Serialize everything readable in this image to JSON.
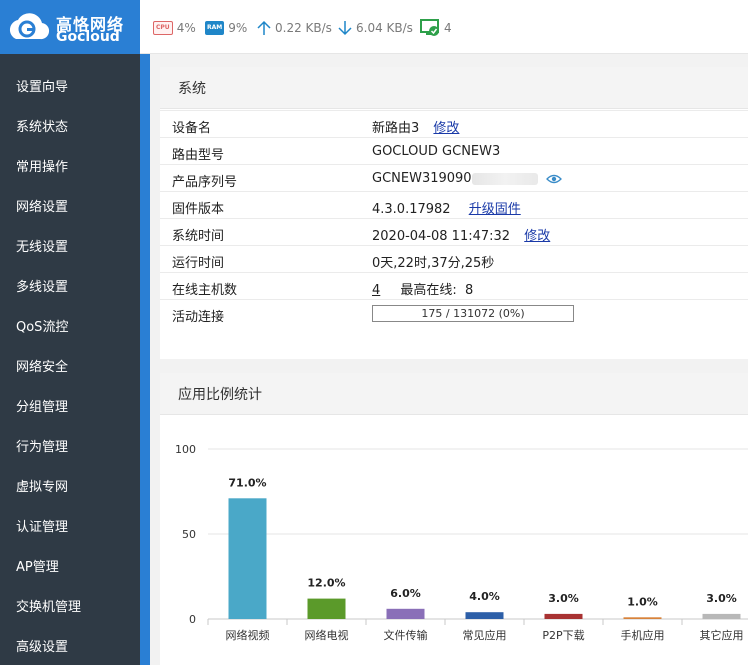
{
  "brand": {
    "name_cn": "高恪网络",
    "name_en": "Gocloud"
  },
  "topbar": {
    "cpu": {
      "icon": "cpu-icon",
      "value": "4%"
    },
    "ram": {
      "icon": "ram-icon",
      "value": "9%"
    },
    "upload": {
      "icon": "upload-arrow-icon",
      "value": "0.22 KB/s"
    },
    "download": {
      "icon": "download-arrow-icon",
      "value": "6.04 KB/s"
    },
    "online": {
      "icon": "online-devices-icon",
      "value": "4"
    }
  },
  "sidebar": {
    "items": [
      {
        "label": "设置向导"
      },
      {
        "label": "系统状态"
      },
      {
        "label": "常用操作"
      },
      {
        "label": "网络设置"
      },
      {
        "label": "无线设置"
      },
      {
        "label": "多线设置"
      },
      {
        "label": "QoS流控"
      },
      {
        "label": "网络安全"
      },
      {
        "label": "分组管理"
      },
      {
        "label": "行为管理"
      },
      {
        "label": "虚拟专网"
      },
      {
        "label": "认证管理"
      },
      {
        "label": "AP管理"
      },
      {
        "label": "交换机管理"
      },
      {
        "label": "高级设置"
      }
    ]
  },
  "system": {
    "title": "系统",
    "device_name": {
      "label": "设备名",
      "value": "新路由3",
      "action": "修改"
    },
    "model": {
      "label": "路由型号",
      "value": "GOCLOUD GCNEW3"
    },
    "serial": {
      "label": "产品序列号",
      "value": "GCNEW319090"
    },
    "firmware": {
      "label": "固件版本",
      "value": "4.3.0.17982",
      "action": "升级固件"
    },
    "time": {
      "label": "系统时间",
      "value": "2020-04-08 11:47:32",
      "action": "修改"
    },
    "uptime": {
      "label": "运行时间",
      "value": "0天,22时,37分,25秒"
    },
    "hosts": {
      "label": "在线主机数",
      "value": "4",
      "max_label": "最高在线:",
      "max_value": "8"
    },
    "connections": {
      "label": "活动连接",
      "value": "175 / 131072 (0%)",
      "ratio": 0.0013
    }
  },
  "app_stats": {
    "title": "应用比例统计"
  },
  "chart_data": {
    "type": "bar",
    "categories": [
      "网络视频",
      "网络电视",
      "文件传输",
      "常见应用",
      "P2P下载",
      "手机应用",
      "其它应用"
    ],
    "values": [
      71.0,
      12.0,
      6.0,
      4.0,
      3.0,
      1.0,
      3.0
    ],
    "data_labels": [
      "71.0%",
      "12.0%",
      "6.0%",
      "4.0%",
      "3.0%",
      "1.0%",
      "3.0%"
    ],
    "colors": [
      "#4aa8c8",
      "#5b9a2a",
      "#8a6fb8",
      "#2d5fa8",
      "#a83232",
      "#d8823a",
      "#b8b8b8"
    ],
    "ylim": [
      0,
      100
    ],
    "yticks": [
      "0",
      "50",
      "100"
    ],
    "grid": true,
    "title": "",
    "xlabel": "",
    "ylabel": ""
  }
}
